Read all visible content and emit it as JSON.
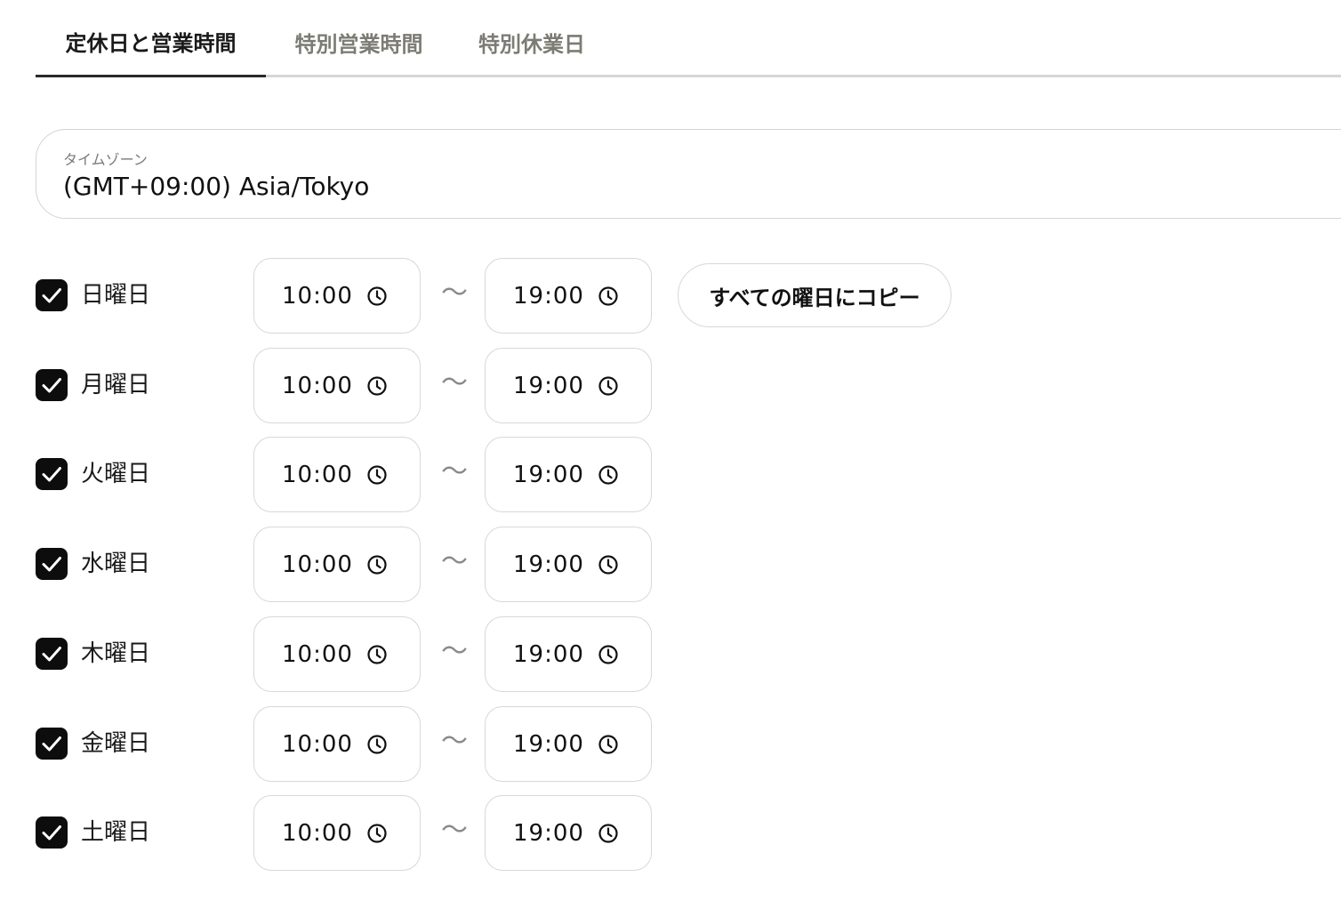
{
  "tabs": [
    {
      "label": "定休日と営業時間",
      "active": true
    },
    {
      "label": "特別営業時間",
      "active": false
    },
    {
      "label": "特別休業日",
      "active": false
    }
  ],
  "timezone": {
    "label": "タイムゾーン",
    "value": "(GMT+09:00) Asia/Tokyo"
  },
  "copy_button_label": "すべての曜日にコピー",
  "range_separator": "〜",
  "days": [
    {
      "label": "日曜日",
      "checked": true,
      "start": "10:00",
      "end": "19:00"
    },
    {
      "label": "月曜日",
      "checked": true,
      "start": "10:00",
      "end": "19:00"
    },
    {
      "label": "火曜日",
      "checked": true,
      "start": "10:00",
      "end": "19:00"
    },
    {
      "label": "水曜日",
      "checked": true,
      "start": "10:00",
      "end": "19:00"
    },
    {
      "label": "木曜日",
      "checked": true,
      "start": "10:00",
      "end": "19:00"
    },
    {
      "label": "金曜日",
      "checked": true,
      "start": "10:00",
      "end": "19:00"
    },
    {
      "label": "土曜日",
      "checked": true,
      "start": "10:00",
      "end": "19:00"
    }
  ],
  "colors": {
    "active_tab": "#1a1a1a",
    "inactive_tab": "#7c7c74",
    "checkbox": "#0d0d0d",
    "border": "#d8d8d8"
  },
  "icons": {
    "checkbox": "check-icon",
    "time": "clock-icon"
  }
}
